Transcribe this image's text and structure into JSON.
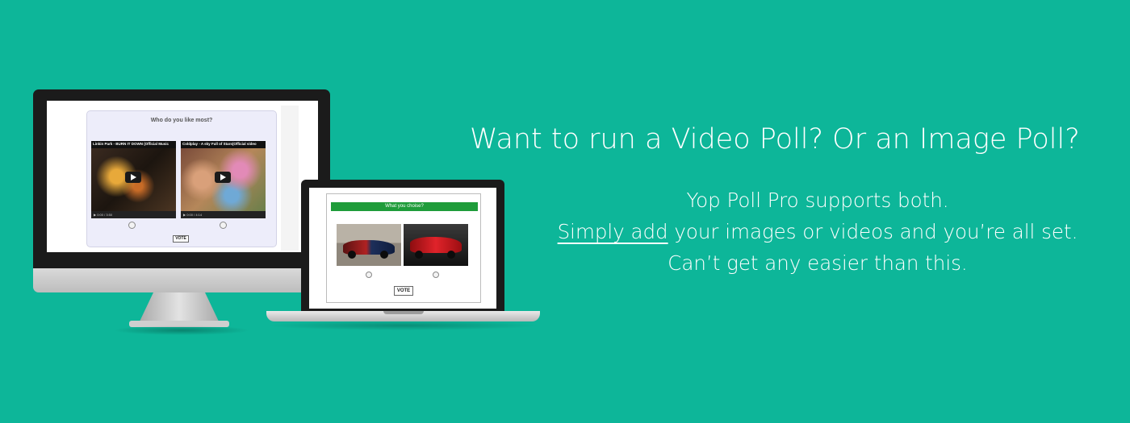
{
  "brand_colors": {
    "background": "#0db699",
    "poll_header": "#1f9c3a",
    "text": "#ffffff"
  },
  "desktop_poll": {
    "question": "Who do you like most?",
    "videos": [
      {
        "title": "Linkin Park - BURN IT DOWN (Official Music",
        "time": "0:00 / 3:50"
      },
      {
        "title": "Coldplay - A sky Full of Stars(Official video",
        "time": "0:00 / 4:14"
      }
    ],
    "vote_label": "VOTE"
  },
  "laptop_poll": {
    "title": "What you choise?",
    "vote_label": "VOTE"
  },
  "headline": "Want to run a Video Poll? Or an Image Poll?",
  "body": {
    "line1": "Yop Poll Pro supports both.",
    "line2_link": "Simply add",
    "line2_rest": " your images or videos and you’re all set.",
    "line3": "Can’t get any easier than this."
  }
}
